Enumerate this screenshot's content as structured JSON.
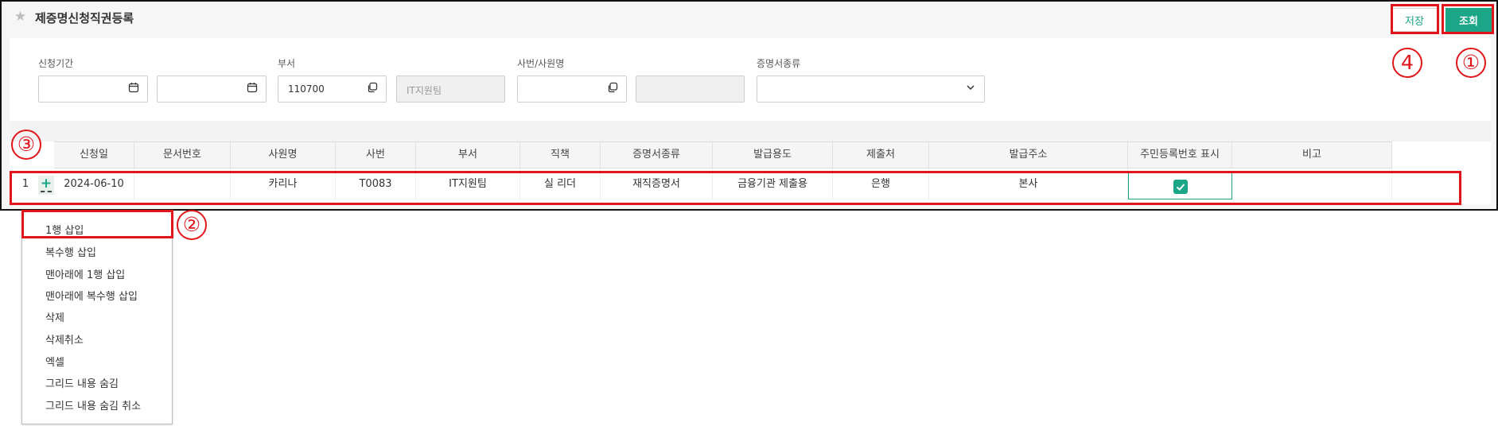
{
  "header": {
    "title": "제증명신청직권등록",
    "save_label": "저장",
    "search_label": "조회"
  },
  "annotations": [
    "①",
    "②",
    "③",
    "4"
  ],
  "filters": {
    "period_label": "신청기간",
    "period_from": "",
    "period_to": "",
    "dept_label": "부서",
    "dept_code": "110700",
    "dept_name": "IT지원팀",
    "emp_label": "사번/사원명",
    "emp_id": "",
    "emp_name": "",
    "cert_label": "증명서종류",
    "cert_value": ""
  },
  "grid": {
    "columns": [
      "신청일",
      "문서번호",
      "사원명",
      "사번",
      "부서",
      "직책",
      "증명서종류",
      "발급용도",
      "제출처",
      "발급주소",
      "주민등록번호 표시",
      "비고"
    ],
    "rows": [
      {
        "num": "1",
        "cells": [
          "2024-06-10",
          "",
          "카리나",
          "T0083",
          "IT지원팀",
          "실 리더",
          "재직증명서",
          "금융기관 제출용",
          "은행",
          "본사",
          "",
          ""
        ],
        "show_ssn": true
      }
    ]
  },
  "context_menu": {
    "items": [
      "1행 삽입",
      "복수행 삽입",
      "맨아래에 1행 삽입",
      "맨아래에 복수행 삽입",
      "삭제",
      "삭제취소",
      "엑셀",
      "그리드 내용 숨김",
      "그리드 내용 숨김 취소"
    ]
  },
  "colors": {
    "accent": "#1aa687",
    "highlight": "#e0161b"
  },
  "icons": [
    "star-icon",
    "calendar-icon",
    "copy-icon",
    "chevron-down-icon",
    "plus-icon",
    "check-icon"
  ]
}
